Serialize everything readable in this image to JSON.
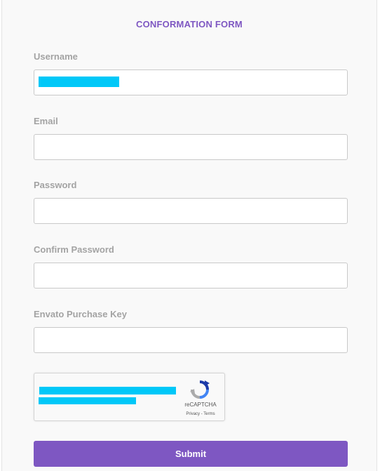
{
  "form": {
    "title": "CONFORMATION FORM",
    "fields": [
      {
        "label": "Username",
        "value": ""
      },
      {
        "label": "Email",
        "value": ""
      },
      {
        "label": "Password",
        "value": ""
      },
      {
        "label": "Confirm Password",
        "value": ""
      },
      {
        "label": "Envato Purchase Key",
        "value": ""
      }
    ],
    "captcha": {
      "brand": "reCAPTCHA",
      "links": "Privacy - Terms",
      "icon": "recaptcha-icon"
    },
    "submit_label": "Submit"
  },
  "colors": {
    "accent": "#7e57c2",
    "label": "#a3a3a3",
    "redaction": "#00c8f8"
  }
}
